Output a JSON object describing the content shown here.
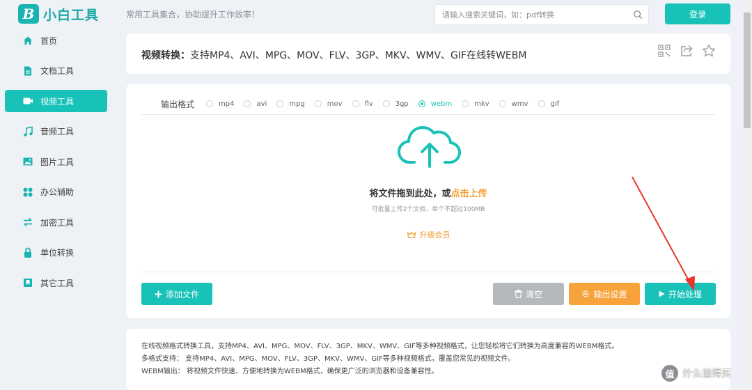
{
  "brand": {
    "logo_mark": "B",
    "name": "小白工具",
    "slogan": "常用工具集合，协助提升工作效率！"
  },
  "search": {
    "placeholder": "请输入搜索关键词，如：pdf转换",
    "icon": "search-icon"
  },
  "header": {
    "login_label": "登录"
  },
  "sidebar": {
    "items": [
      {
        "label": "首页",
        "icon": "home-icon",
        "active": false
      },
      {
        "label": "文档工具",
        "icon": "document-icon",
        "active": false
      },
      {
        "label": "视频工具",
        "icon": "video-icon",
        "active": true
      },
      {
        "label": "音频工具",
        "icon": "music-icon",
        "active": false
      },
      {
        "label": "图片工具",
        "icon": "image-icon",
        "active": false
      },
      {
        "label": "办公辅助",
        "icon": "grid-icon",
        "active": false
      },
      {
        "label": "加密工具",
        "icon": "swap-icon",
        "active": false
      },
      {
        "label": "单位转换",
        "icon": "lock-icon",
        "active": false
      },
      {
        "label": "其它工具",
        "icon": "bookmark-icon",
        "active": false
      }
    ]
  },
  "page": {
    "title_prefix": "视频转换：",
    "title_rest": "支持MP4、AVI、MPG、MOV、FLV、3GP、MKV、WMV、GIF在线转WEBM",
    "tools": [
      "qrcode-icon",
      "share-icon",
      "star-icon"
    ]
  },
  "converter": {
    "format_label": "输出格式",
    "formats": [
      "mp4",
      "avi",
      "mpg",
      "mov",
      "flv",
      "3gp",
      "webm",
      "mkv",
      "wmv",
      "gif"
    ],
    "selected_format": "webm",
    "drop_text": "将文件拖到此处，或",
    "drop_link": "点击上传",
    "drop_sub": "可批量上传2个文档，单个不超过100MB",
    "upgrade_label": "升级会员",
    "add_file_label": "添加文件",
    "clear_label": "清空",
    "settings_label": "输出设置",
    "start_label": "开始处理",
    "colors": {
      "accent": "#19c2b8",
      "orange": "#f7a23a",
      "gray": "#b5b9bc",
      "annotation_arrow": "#e8342c"
    }
  },
  "description": {
    "lines": [
      "在线视频格式转换工具，支持MP4、AVI、MPG、MOV、FLV、3GP、MKV、WMV、GIF等多种视频格式，让您轻松将它们转换为高度兼容的WEBM格式。",
      "多格式支持： 支持MP4、AVI、MPG、MOV、FLV、3GP、MKV、WMV、GIF等多种视频格式，覆盖您常见的视频文件。",
      "WEBM输出： 将视频文件快速、方便地转换为WEBM格式，确保更广泛的浏览器和设备兼容性。"
    ]
  },
  "watermark": {
    "badge": "值",
    "text": "什么值得买"
  }
}
